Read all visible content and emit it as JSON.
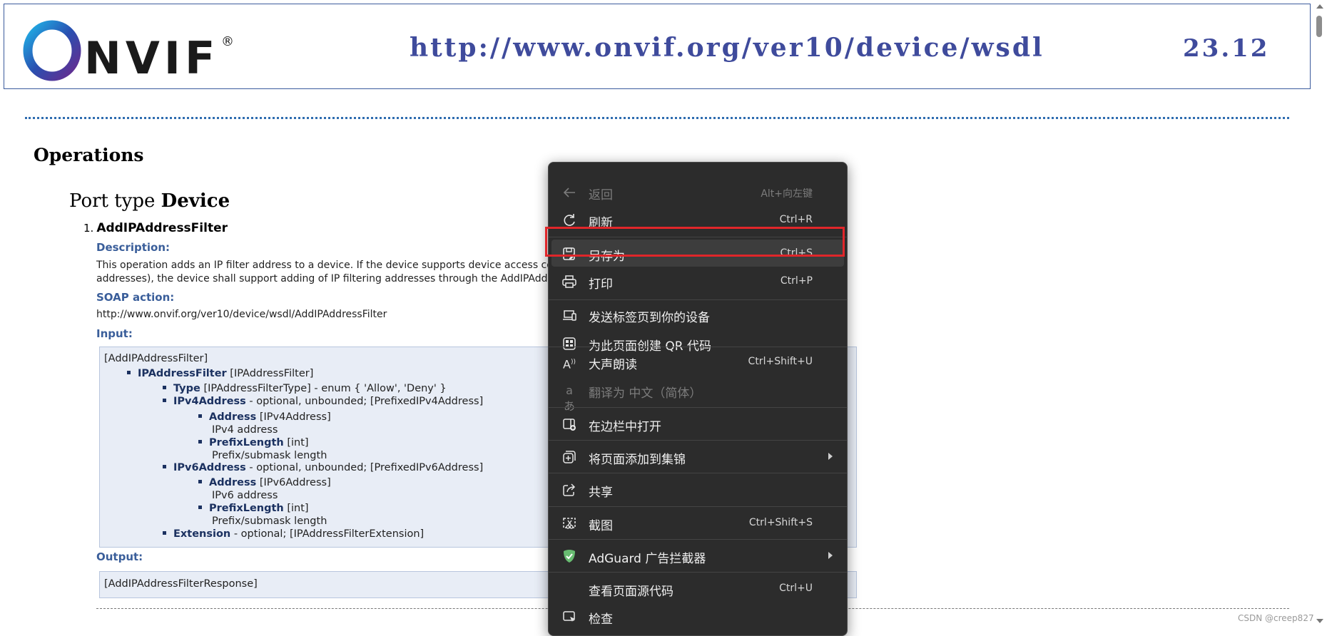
{
  "header": {
    "logo_text": "ONVIF",
    "url": "http://www.onvif.org/ver10/device/wsdl",
    "version": "23.12"
  },
  "document": {
    "heading": "Operations",
    "port_type_prefix": "Port type",
    "port_type_name": "Device",
    "operation_number": "1.",
    "operation_name": "AddIPAddressFilter",
    "description_label": "Description:",
    "description_line1": "This operation adds an IP filter address to a device. If the device supports device access contro",
    "description_line2": "addresses), the device shall support adding of IP filtering addresses through the AddIPAddressF",
    "soap_label": "SOAP action:",
    "soap_value": "http://www.onvif.org/ver10/device/wsdl/AddIPAddressFilter",
    "input_label": "Input:",
    "input_root": "[AddIPAddressFilter]",
    "input_tree": [
      {
        "name": "IPAddressFilter",
        "rest": " [IPAddressFilter]"
      },
      {
        "name": "Type",
        "rest": " [IPAddressFilterType] - enum { 'Allow', 'Deny' }"
      },
      {
        "name": "IPv4Address",
        "rest": " - optional, unbounded; [PrefixedIPv4Address]"
      },
      {
        "name": "Address",
        "rest": " [IPv4Address]"
      },
      {
        "text": "IPv4 address"
      },
      {
        "name": "PrefixLength",
        "rest": " [int]"
      },
      {
        "text": "Prefix/submask length"
      },
      {
        "name": "IPv6Address",
        "rest": " - optional, unbounded; [PrefixedIPv6Address]"
      },
      {
        "name": "Address",
        "rest": " [IPv6Address]"
      },
      {
        "text": "IPv6 address"
      },
      {
        "name": "PrefixLength",
        "rest": " [int]"
      },
      {
        "text": "Prefix/submask length"
      },
      {
        "name": "Extension",
        "rest": " - optional; [IPAddressFilterExtension]"
      }
    ],
    "output_label": "Output:",
    "output_root": "[AddIPAddressFilterResponse]"
  },
  "context_menu": {
    "items": [
      {
        "label": "返回",
        "shortcut": "Alt+向左键",
        "icon": "back-arrow-icon",
        "disabled": true
      },
      {
        "label": "刷新",
        "shortcut": "Ctrl+R",
        "icon": "refresh-icon"
      },
      {
        "label": "另存为",
        "shortcut": "Ctrl+S",
        "icon": "save-as-icon",
        "highlighted": true
      },
      {
        "label": "打印",
        "shortcut": "Ctrl+P",
        "icon": "print-icon"
      },
      {
        "label": "发送标签页到你的设备",
        "shortcut": "",
        "icon": "send-to-device-icon"
      },
      {
        "label": "为此页面创建 QR 代码",
        "shortcut": "",
        "icon": "qr-code-icon"
      },
      {
        "label": "大声朗读",
        "shortcut": "Ctrl+Shift+U",
        "icon": "read-aloud-icon"
      },
      {
        "label": "翻译为 中文（简体）",
        "shortcut": "",
        "icon": "translate-icon",
        "disabled": true
      },
      {
        "label": "在边栏中打开",
        "shortcut": "",
        "icon": "sidebar-icon"
      },
      {
        "label": "将页面添加到集锦",
        "shortcut": "",
        "icon": "collections-icon",
        "submenu": true
      },
      {
        "label": "共享",
        "shortcut": "",
        "icon": "share-icon"
      },
      {
        "label": "截图",
        "shortcut": "Ctrl+Shift+S",
        "icon": "screenshot-icon"
      },
      {
        "label": "AdGuard 广告拦截器",
        "shortcut": "",
        "icon": "adguard-shield-icon",
        "submenu": true
      },
      {
        "label": "查看页面源代码",
        "shortcut": "Ctrl+U",
        "icon": ""
      },
      {
        "label": "检查",
        "shortcut": "",
        "icon": "inspect-icon"
      }
    ]
  },
  "watermark": "CSDN @creep827",
  "colors": {
    "header_text": "#3f4b9c",
    "section_label": "#3a5e9a",
    "menu_bg": "#2c2c2c",
    "highlight_border": "#e0262a",
    "adguard_green": "#68bc71"
  }
}
